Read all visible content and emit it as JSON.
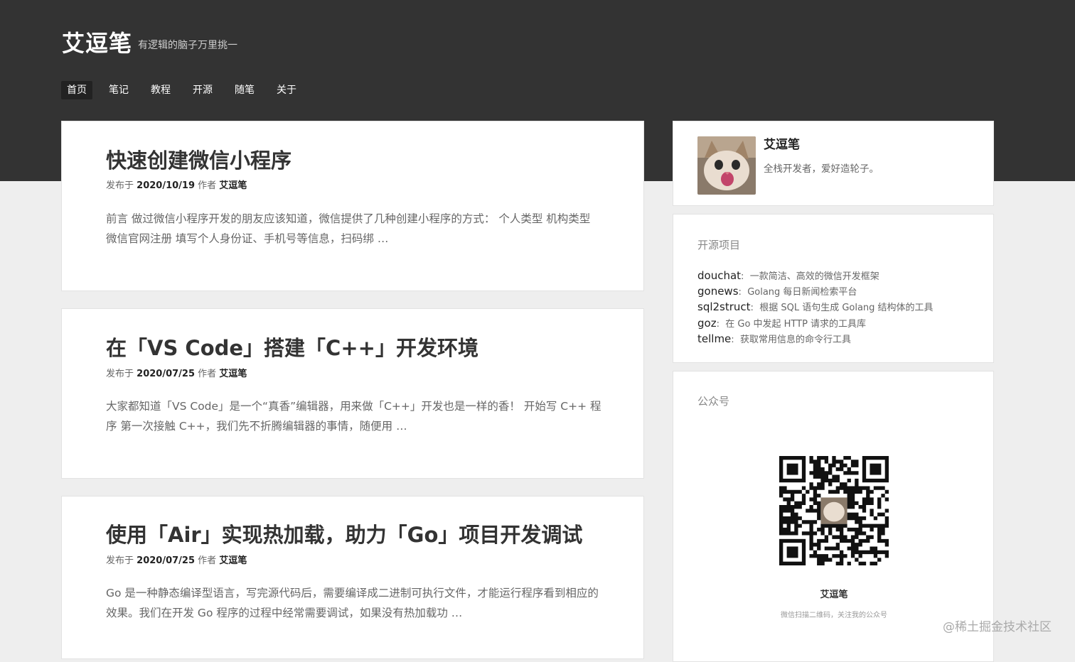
{
  "site": {
    "title": "艾逗笔",
    "description": "有逻辑的脑子万里挑一"
  },
  "nav": [
    {
      "label": "首页",
      "active": true
    },
    {
      "label": "笔记",
      "active": false
    },
    {
      "label": "教程",
      "active": false
    },
    {
      "label": "开源",
      "active": false
    },
    {
      "label": "随笔",
      "active": false
    },
    {
      "label": "关于",
      "active": false
    }
  ],
  "posts": [
    {
      "title": "快速创建微信小程序",
      "meta_prefix": "发布于",
      "date": "2020/10/19",
      "author_prefix": "作者",
      "author": "艾逗笔",
      "excerpt": "前言 做过微信小程序开发的朋友应该知道，微信提供了几种创建小程序的方式： 个人类型 机构类型 微信官网注册 填写个人身份证、手机号等信息，扫码绑 …"
    },
    {
      "title": "在「VS Code」搭建「C++」开发环境",
      "meta_prefix": "发布于",
      "date": "2020/07/25",
      "author_prefix": "作者",
      "author": "艾逗笔",
      "excerpt": "大家都知道「VS Code」是一个“真香”编辑器，用来做「C++」开发也是一样的香！ 开始写 C++ 程序 第一次接触 C++，我们先不折腾编辑器的事情，随便用 …"
    },
    {
      "title": "使用「Air」实现热加载，助力「Go」项目开发调试",
      "meta_prefix": "发布于",
      "date": "2020/07/25",
      "author_prefix": "作者",
      "author": "艾逗笔",
      "excerpt": "Go 是一种静态编译型语言，写完源代码后，需要编译成二进制可执行文件，才能运行程序看到相应的效果。我们在开发 Go 程序的过程中经常需要调试，如果没有热加载功 …"
    }
  ],
  "profile": {
    "name": "艾逗笔",
    "bio": "全栈开发者，爱好造轮子。"
  },
  "projects": {
    "title": "开源项目",
    "items": [
      {
        "name": "douchat",
        "desc": "一款简洁、高效的微信开发框架"
      },
      {
        "name": "gonews",
        "desc": "Golang 每日新闻检索平台"
      },
      {
        "name": "sql2struct",
        "desc": "根据 SQL 语句生成 Golang 结构体的工具"
      },
      {
        "name": "goz",
        "desc": "在 Go 中发起 HTTP 请求的工具库"
      },
      {
        "name": "tellme",
        "desc": "获取常用信息的命令行工具"
      }
    ]
  },
  "wechat": {
    "title": "公众号",
    "name": "艾逗笔",
    "desc": "微信扫描二维码，关注我的公众号"
  },
  "watermark": "@稀土掘金技术社区",
  "icons": {
    "avatar": "cat-avatar-image",
    "qr": "qr-code-image"
  },
  "colors": {
    "header_bg": "#333333",
    "page_bg": "#eeeeee"
  }
}
